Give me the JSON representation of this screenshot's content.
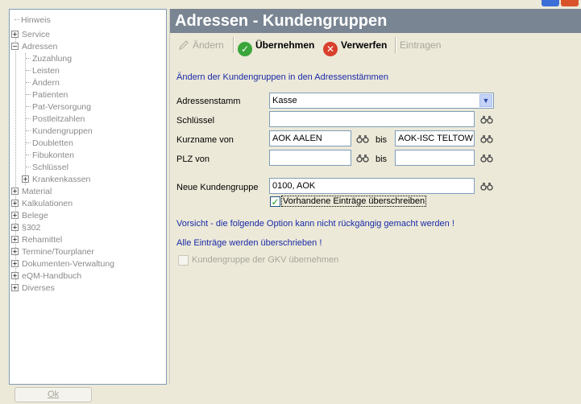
{
  "tree": {
    "items": [
      {
        "label": "Hinweis",
        "type": "leaf",
        "level": 0
      },
      {
        "label": "Service",
        "type": "collapsed",
        "level": 0
      },
      {
        "label": "Adressen",
        "type": "expanded",
        "level": 0
      },
      {
        "label": "Zuzahlung",
        "type": "leaf",
        "level": 1
      },
      {
        "label": "Leisten",
        "type": "leaf",
        "level": 1
      },
      {
        "label": "Ändern",
        "type": "leaf",
        "level": 1
      },
      {
        "label": "Patienten",
        "type": "leaf",
        "level": 1
      },
      {
        "label": "Pat-Versorgung",
        "type": "leaf",
        "level": 1
      },
      {
        "label": "Postleitzahlen",
        "type": "leaf",
        "level": 1
      },
      {
        "label": "Kundengruppen",
        "type": "leaf",
        "level": 1
      },
      {
        "label": "Doubletten",
        "type": "leaf",
        "level": 1
      },
      {
        "label": "Fibukonten",
        "type": "leaf",
        "level": 1
      },
      {
        "label": "Schlüssel",
        "type": "leaf",
        "level": 1
      },
      {
        "label": "Krankenkassen",
        "type": "collapsed",
        "level": 1
      },
      {
        "label": "Material",
        "type": "collapsed",
        "level": 0
      },
      {
        "label": "Kalkulationen",
        "type": "collapsed",
        "level": 0
      },
      {
        "label": "Belege",
        "type": "collapsed",
        "level": 0
      },
      {
        "label": "§302",
        "type": "collapsed",
        "level": 0
      },
      {
        "label": "Rehamittel",
        "type": "collapsed",
        "level": 0
      },
      {
        "label": "Termine/Tourplaner",
        "type": "collapsed",
        "level": 0
      },
      {
        "label": "Dokumenten-Verwaltung",
        "type": "collapsed",
        "level": 0
      },
      {
        "label": "eQM-Handbuch",
        "type": "collapsed",
        "level": 0
      },
      {
        "label": "Diverses",
        "type": "collapsed",
        "level": 0
      }
    ]
  },
  "panel": {
    "title": "Adressen - Kundengruppen",
    "toolbar": {
      "aendern": "Ändern",
      "uebernehmen": "Übernehmen",
      "verwerfen": "Verwerfen",
      "eintragen": "Eintragen"
    },
    "description": "Ändern der Kundengruppen in den Adressenstämmen",
    "form": {
      "adressenstamm_label": "Adressenstamm",
      "adressenstamm_value": "Kasse",
      "schluessel_label": "Schlüssel",
      "schluessel_value": "",
      "kurzname_label": "Kurzname von",
      "kurzname_von": "AOK AALEN",
      "bis": "bis",
      "kurzname_bis": "AOK-ISC TELTOW",
      "plz_label": "PLZ von",
      "plz_von": "",
      "plz_bis": "",
      "neue_label": "Neue Kundengruppe",
      "neue_value": "0100, AOK",
      "ueberschreiben_label": "Vorhandene Einträge überschreiben",
      "ueberschreiben_checked": true
    },
    "warning1": "Vorsicht - die folgende Option kann nicht rückgängig gemacht werden !",
    "warning2": "Alle Einträge werden überschrieben !",
    "gkv_label": "Kundengruppe der GKV übernehmen"
  },
  "footer": {
    "ok_label": "Ok"
  },
  "colors": {
    "title_bar": "#7a8593",
    "info_text": "#1a2aa8",
    "disabled_text": "#a7a69a",
    "accent_check": "#3aa53a",
    "accent_cross": "#d8402c"
  }
}
